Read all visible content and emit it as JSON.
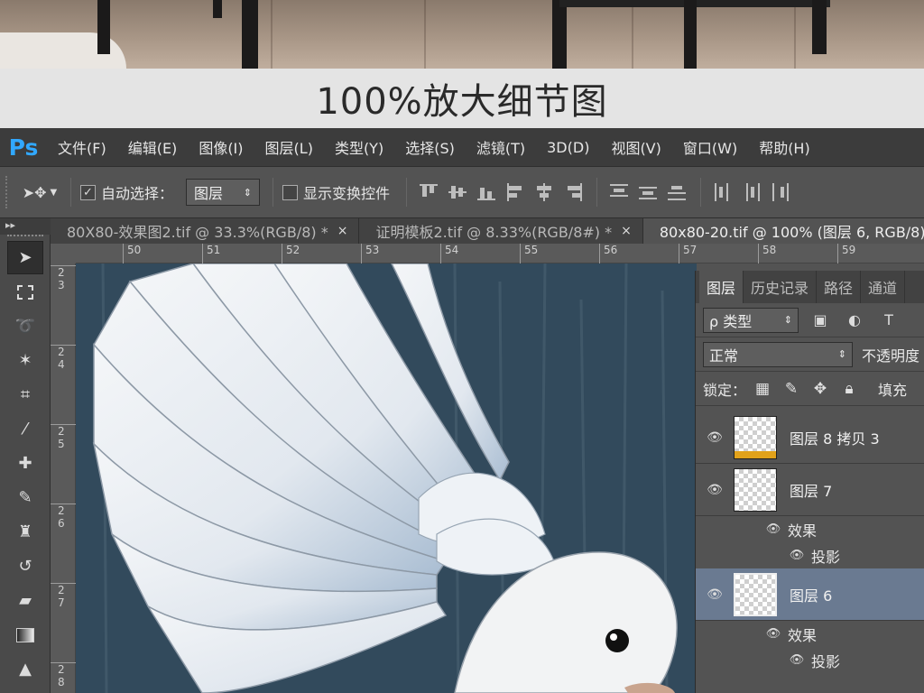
{
  "caption": "100%放大细节图",
  "app": {
    "logo": "Ps",
    "menu": [
      "文件(F)",
      "编辑(E)",
      "图像(I)",
      "图层(L)",
      "类型(Y)",
      "选择(S)",
      "滤镜(T)",
      "3D(D)",
      "视图(V)",
      "窗口(W)",
      "帮助(H)"
    ]
  },
  "options": {
    "move_tool_icon": "move-icon",
    "auto_select_label": "自动选择：",
    "auto_select_checked": true,
    "auto_select_target": "图层",
    "show_transform_label": "显示变换控件",
    "show_transform_checked": false
  },
  "tabs": [
    {
      "label": "80X80-效果图2.tif @ 33.3%(RGB/8) *",
      "active": false
    },
    {
      "label": "证明模板2.tif @ 8.33%(RGB/8#) *",
      "active": false
    },
    {
      "label": "80x80-20.tif @ 100% (图层 6, RGB/8)",
      "active": true
    }
  ],
  "tab_close": "×",
  "ruler": {
    "top_ticks": [
      "50",
      "51",
      "52",
      "53",
      "54",
      "55",
      "56",
      "57",
      "58",
      "59"
    ],
    "left_ticks": [
      "2\n3",
      "2\n4",
      "2\n5",
      "2\n6",
      "2\n7",
      "2\n8"
    ]
  },
  "layers_panel": {
    "tabs": [
      "图层",
      "历史记录",
      "路径",
      "通道"
    ],
    "filter_label": "ρ 类型",
    "blend_mode": "正常",
    "opacity_label": "不透明度",
    "lock_label": "锁定：",
    "fill_label": "填充",
    "layers": [
      {
        "name": "图层 8 拷贝 3",
        "visible": true,
        "selected": false,
        "thumb": "gold"
      },
      {
        "name": "图层 7",
        "visible": true,
        "selected": false,
        "thumb": "plain",
        "effects_label": "效果",
        "effect": "投影"
      },
      {
        "name": "图层 6",
        "visible": true,
        "selected": true,
        "thumb": "plain",
        "effects_label": "效果",
        "effect": "投影"
      }
    ]
  }
}
